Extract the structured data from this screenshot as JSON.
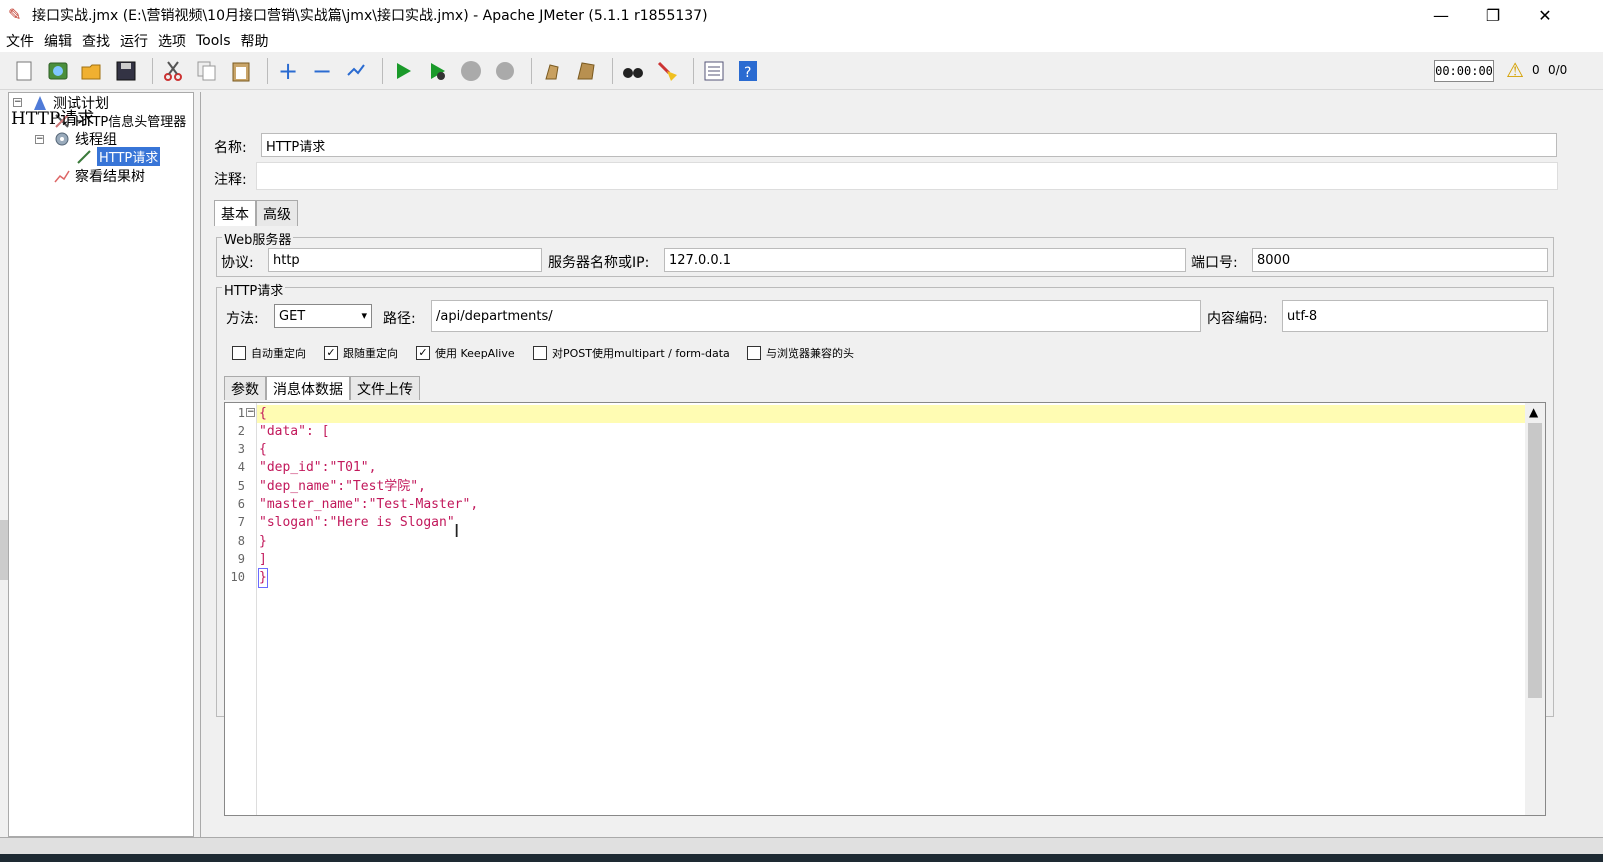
{
  "window": {
    "title": "接口实战.jmx (E:\\营销视频\\10月接口营销\\实战篇\\jmx\\接口实战.jmx) - Apache JMeter (5.1.1 r1855137)",
    "minimize": "—",
    "maximize": "❐",
    "close": "✕"
  },
  "menu": [
    "文件",
    "编辑",
    "查找",
    "运行",
    "选项",
    "Tools",
    "帮助"
  ],
  "status": {
    "timer": "00:00:00",
    "warning_count": "0",
    "threads": "0/0"
  },
  "tree": {
    "plan": "测试计划",
    "header_manager": "HTTP信息头管理器",
    "thread_group": "线程组",
    "http_request": "HTTP请求",
    "result_tree": "察看结果树"
  },
  "panel": {
    "title": "HTTP请求",
    "name_label": "名称:",
    "name_value": "HTTP请求",
    "comment_label": "注释:"
  },
  "tabs": {
    "basic": "基本",
    "advanced": "高级"
  },
  "web_server": {
    "group_title": "Web服务器",
    "protocol_label": "协议:",
    "protocol_value": "http",
    "server_label": "服务器名称或IP:",
    "server_value": "127.0.0.1",
    "port_label": "端口号:",
    "port_value": "8000"
  },
  "http_request": {
    "group_title": "HTTP请求",
    "method_label": "方法:",
    "method_value": "GET",
    "path_label": "路径:",
    "path_value": "/api/departments/",
    "encoding_label": "内容编码:",
    "encoding_value": "utf-8"
  },
  "checkboxes": [
    {
      "label": "自动重定向",
      "checked": false
    },
    {
      "label": "跟随重定向",
      "checked": true
    },
    {
      "label": "使用 KeepAlive",
      "checked": true
    },
    {
      "label": "对POST使用multipart / form-data",
      "checked": false
    },
    {
      "label": "与浏览器兼容的头",
      "checked": false
    }
  ],
  "subtabs": {
    "params": "参数",
    "body": "消息体数据",
    "files": "文件上传"
  },
  "editor": {
    "line_numbers": [
      "1",
      "2",
      "3",
      "4",
      "5",
      "6",
      "7",
      "8",
      "9",
      "10"
    ],
    "lines": [
      "{",
      "\"data\": [",
      "{",
      "\"dep_id\":\"T01\",",
      "\"dep_name\":\"Test学院\",",
      "\"master_name\":\"Test-Master\",",
      "\"slogan\":\"Here is Slogan\"",
      "}",
      "]",
      "}"
    ]
  }
}
